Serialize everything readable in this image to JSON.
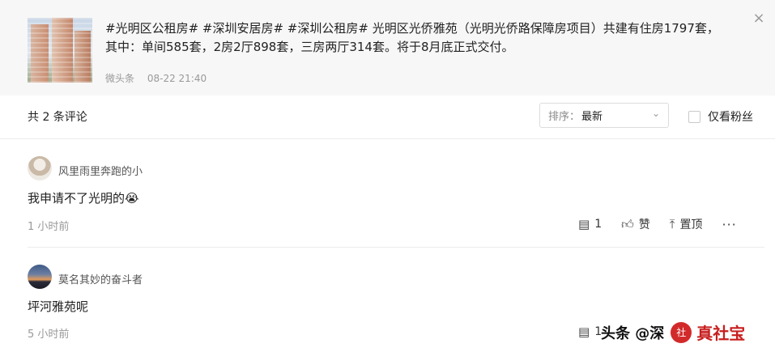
{
  "post": {
    "text_line1": "#光明区公租房# #深圳安居房# #深圳公租房# 光明区光侨雅苑（光明光侨路保障房项目）共建有住房1797套，",
    "text_line2": "其中：单间585套，2房2厅898套，三房两厅314套。将于8月底正式交付。",
    "source": "微头条",
    "time": "08-22 21:40",
    "close_icon": "×"
  },
  "comments_header": {
    "count_text": "共 2 条评论",
    "sort_prefix": "排序：",
    "sort_value": "最新",
    "fans_only_label": "仅看粉丝"
  },
  "comments": [
    {
      "username": "风里雨里奔跑的小",
      "text": "我申请不了光明的😭",
      "time": "1 小时前",
      "reply_count": "1",
      "like_label": "赞",
      "pin_label": "置顶",
      "more": "···"
    },
    {
      "username": "莫名其妙的奋斗者",
      "text": "坪河雅苑呢",
      "time": "5 小时前",
      "reply_count": "1"
    }
  ],
  "watermark": {
    "left_text": "头条 @深",
    "logo_char": "社",
    "right_text": "真社宝"
  }
}
